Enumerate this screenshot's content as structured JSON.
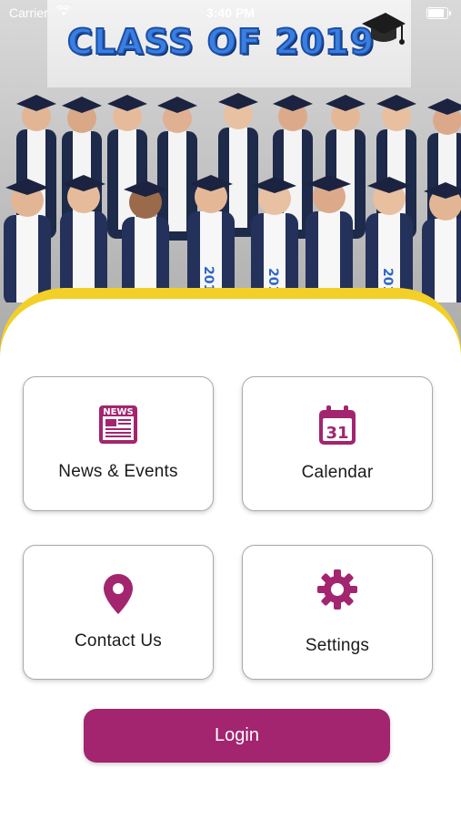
{
  "status_bar": {
    "carrier": "Carrier",
    "time": "3:40 PM"
  },
  "hero": {
    "banner_text": "CLASS OF 2019",
    "sash_text": "2019",
    "banner_color": "#3a7fe0"
  },
  "tiles": [
    {
      "label": "News & Events",
      "icon": "news-icon"
    },
    {
      "label": "Calendar",
      "icon": "calendar-icon",
      "icon_text": "31"
    },
    {
      "label": "Contact Us",
      "icon": "location-pin-icon"
    },
    {
      "label": "Settings",
      "icon": "gear-icon"
    }
  ],
  "news_icon_text": "NEWS",
  "login": {
    "label": "Login"
  },
  "colors": {
    "accent": "#a3256f",
    "yellow": "#f2d027",
    "navy": "#1e2a4a"
  }
}
